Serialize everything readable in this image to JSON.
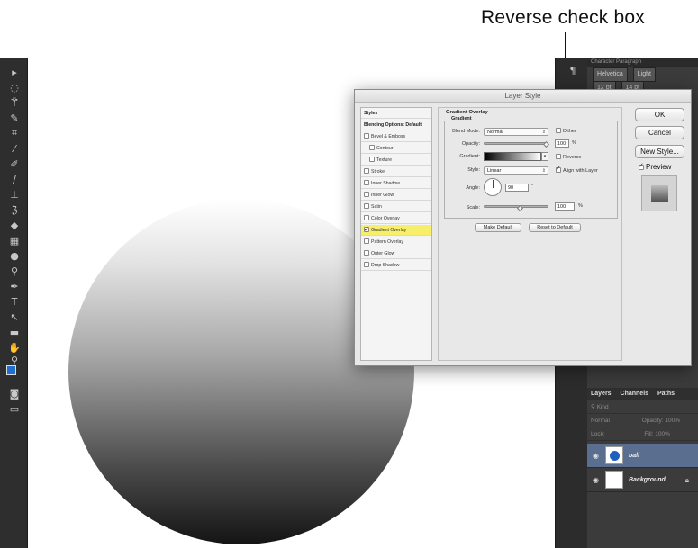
{
  "callout": {
    "label": "Reverse check box"
  },
  "dialog": {
    "title": "Layer Style",
    "left_list": {
      "header": "Styles",
      "blending": "Blending Options: Default",
      "items": [
        {
          "label": "Bevel & Emboss",
          "checked": false
        },
        {
          "label": "Contour",
          "checked": false
        },
        {
          "label": "Texture",
          "checked": false
        },
        {
          "label": "Stroke",
          "checked": false
        },
        {
          "label": "Inner Shadow",
          "checked": false
        },
        {
          "label": "Inner Glow",
          "checked": false
        },
        {
          "label": "Satin",
          "checked": false
        },
        {
          "label": "Color Overlay",
          "checked": false
        },
        {
          "label": "Gradient Overlay",
          "checked": true
        },
        {
          "label": "Pattern Overlay",
          "checked": false
        },
        {
          "label": "Outer Glow",
          "checked": false
        },
        {
          "label": "Drop Shadow",
          "checked": false
        }
      ]
    },
    "gradient_overlay": {
      "title": "Gradient Overlay",
      "subtitle": "Gradient",
      "blend_mode_label": "Blend Mode:",
      "blend_mode": "Normal",
      "dither_label": "Dither",
      "opacity_label": "Opacity:",
      "opacity": "100",
      "opacity_unit": "%",
      "gradient_label": "Gradient:",
      "reverse_label": "Reverse",
      "style_label": "Style:",
      "style": "Linear",
      "align_label": "Align with Layer",
      "angle_label": "Angle:",
      "angle": "90",
      "angle_unit": "°",
      "scale_label": "Scale:",
      "scale": "100",
      "scale_unit": "%",
      "make_default": "Make Default",
      "reset_default": "Reset to Default"
    },
    "buttons": {
      "ok": "OK",
      "cancel": "Cancel",
      "new_style": "New Style...",
      "preview": "Preview"
    }
  },
  "character_panel": {
    "tabs": "Character   Paragraph",
    "font": "Helvetica",
    "weight": "Light",
    "size": "12 pt",
    "leading": "14 pt"
  },
  "layers_panel": {
    "tabs": [
      "Layers",
      "Channels",
      "Paths"
    ],
    "filter": "Kind",
    "blend_mode": "Normal",
    "opacity_label": "Opacity:",
    "opacity": "100%",
    "lock_label": "Lock:",
    "fill_label": "Fill:",
    "fill": "100%",
    "layers": [
      {
        "name": "ball",
        "selected": true
      },
      {
        "name": "Background",
        "selected": false
      }
    ]
  }
}
